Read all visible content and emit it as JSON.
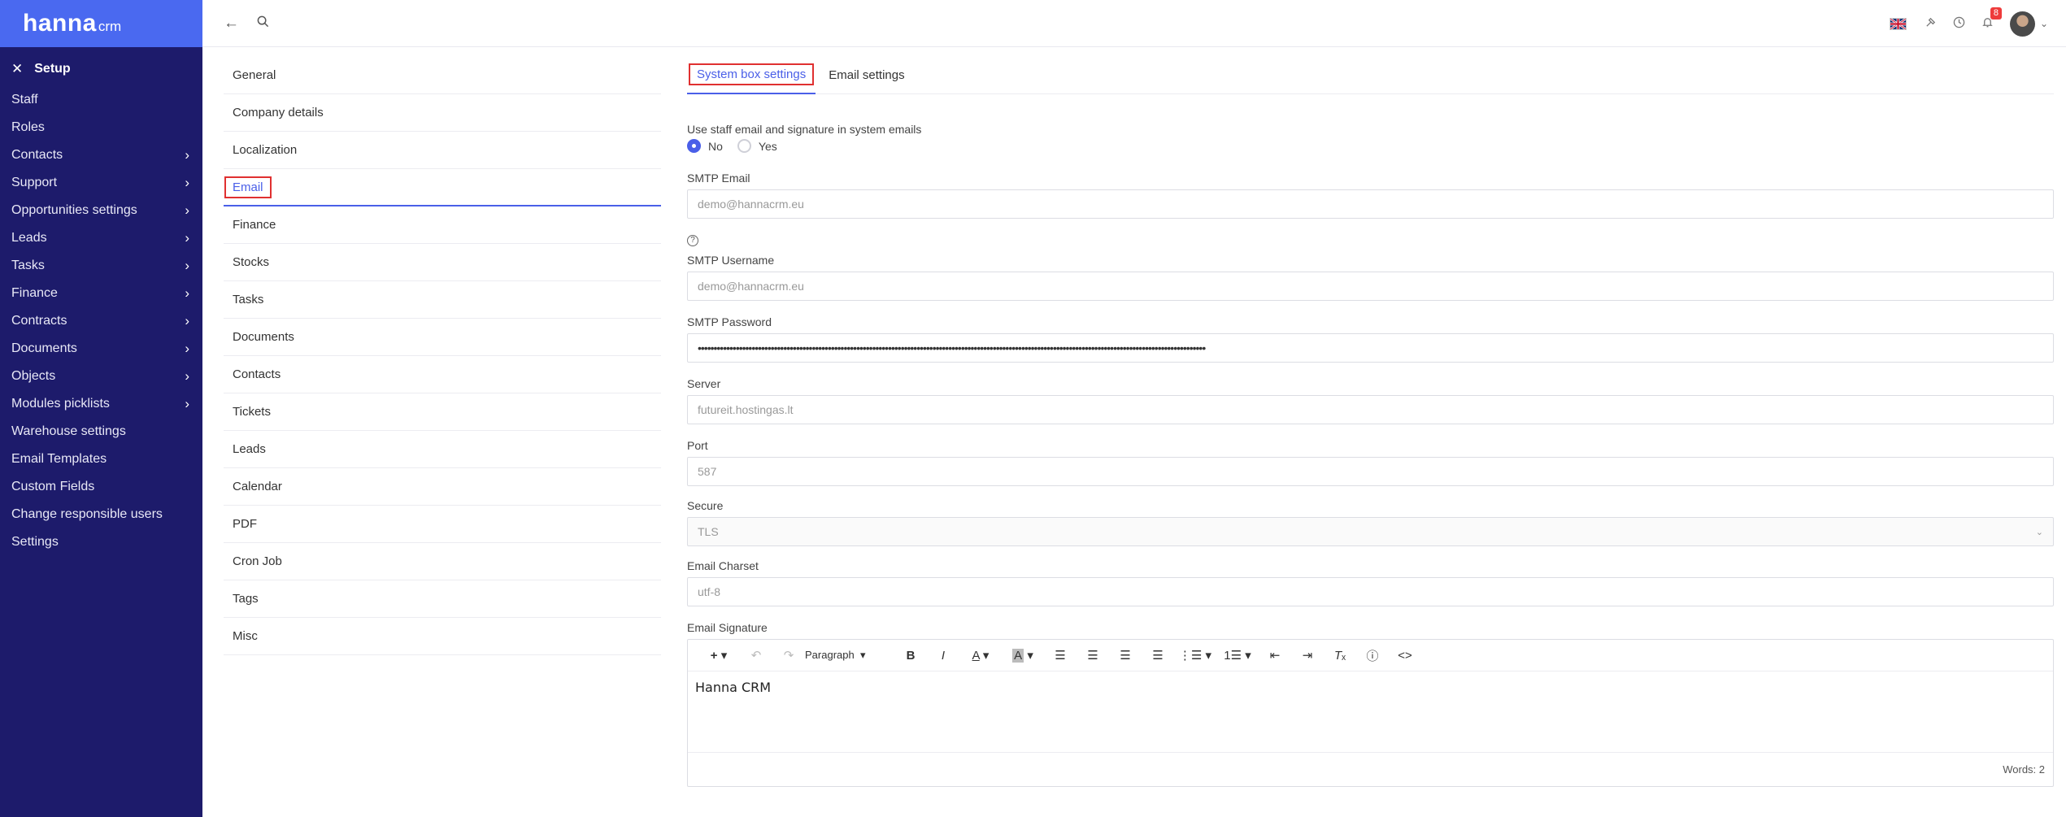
{
  "brand": {
    "name": "hanna",
    "suffix": "crm"
  },
  "sidebar": {
    "setup_label": "Setup",
    "items": [
      {
        "label": "Staff",
        "has_submenu": false
      },
      {
        "label": "Roles",
        "has_submenu": false
      },
      {
        "label": "Contacts",
        "has_submenu": true
      },
      {
        "label": "Support",
        "has_submenu": true
      },
      {
        "label": "Opportunities settings",
        "has_submenu": true
      },
      {
        "label": "Leads",
        "has_submenu": true
      },
      {
        "label": "Tasks",
        "has_submenu": true
      },
      {
        "label": "Finance",
        "has_submenu": true
      },
      {
        "label": "Contracts",
        "has_submenu": true
      },
      {
        "label": "Documents",
        "has_submenu": true
      },
      {
        "label": "Objects",
        "has_submenu": true
      },
      {
        "label": "Modules picklists",
        "has_submenu": true
      },
      {
        "label": "Warehouse settings",
        "has_submenu": false
      },
      {
        "label": "Email Templates",
        "has_submenu": false
      },
      {
        "label": "Custom Fields",
        "has_submenu": false
      },
      {
        "label": "Change responsible users",
        "has_submenu": false
      },
      {
        "label": "Settings",
        "has_submenu": false
      }
    ]
  },
  "header": {
    "notification_count": "8"
  },
  "sections": {
    "active": "Email",
    "items": [
      "General",
      "Company details",
      "Localization",
      "Email",
      "Finance",
      "Stocks",
      "Tasks",
      "Documents",
      "Contacts",
      "Tickets",
      "Leads",
      "Calendar",
      "PDF",
      "Cron Job",
      "Tags",
      "Misc"
    ]
  },
  "tabs": {
    "system_box": "System box settings",
    "email_settings": "Email settings"
  },
  "form": {
    "use_staff_label": "Use staff email and signature in system emails",
    "radio_no": "No",
    "radio_yes": "Yes",
    "smtp_email_label": "SMTP Email",
    "smtp_email_value": "demo@hannacrm.eu",
    "help_glyph": "?",
    "smtp_username_label": "SMTP Username",
    "smtp_username_value": "demo@hannacrm.eu",
    "smtp_password_label": "SMTP Password",
    "smtp_password_value": "••••••••••••••••••••••••••••••••••••••••••••••••••••••••••••••••••••••••••••••••••••••••••••••••••••••••••••••••••••••••••••••••••••••••••••••••••••••••••••••••",
    "server_label": "Server",
    "server_value": "futureit.hostingas.lt",
    "port_label": "Port",
    "port_value": "587",
    "secure_label": "Secure",
    "secure_value": "TLS",
    "charset_label": "Email Charset",
    "charset_value": "utf-8",
    "signature_label": "Email Signature",
    "signature_content": "Hanna CRM",
    "paragraph_label": "Paragraph",
    "word_count": "Words: 2"
  },
  "colors": {
    "sidebar": "#1d1b6b",
    "logo_bar": "#4a69f0",
    "accent": "#4a5fe8",
    "highlight_border": "#e03030"
  }
}
